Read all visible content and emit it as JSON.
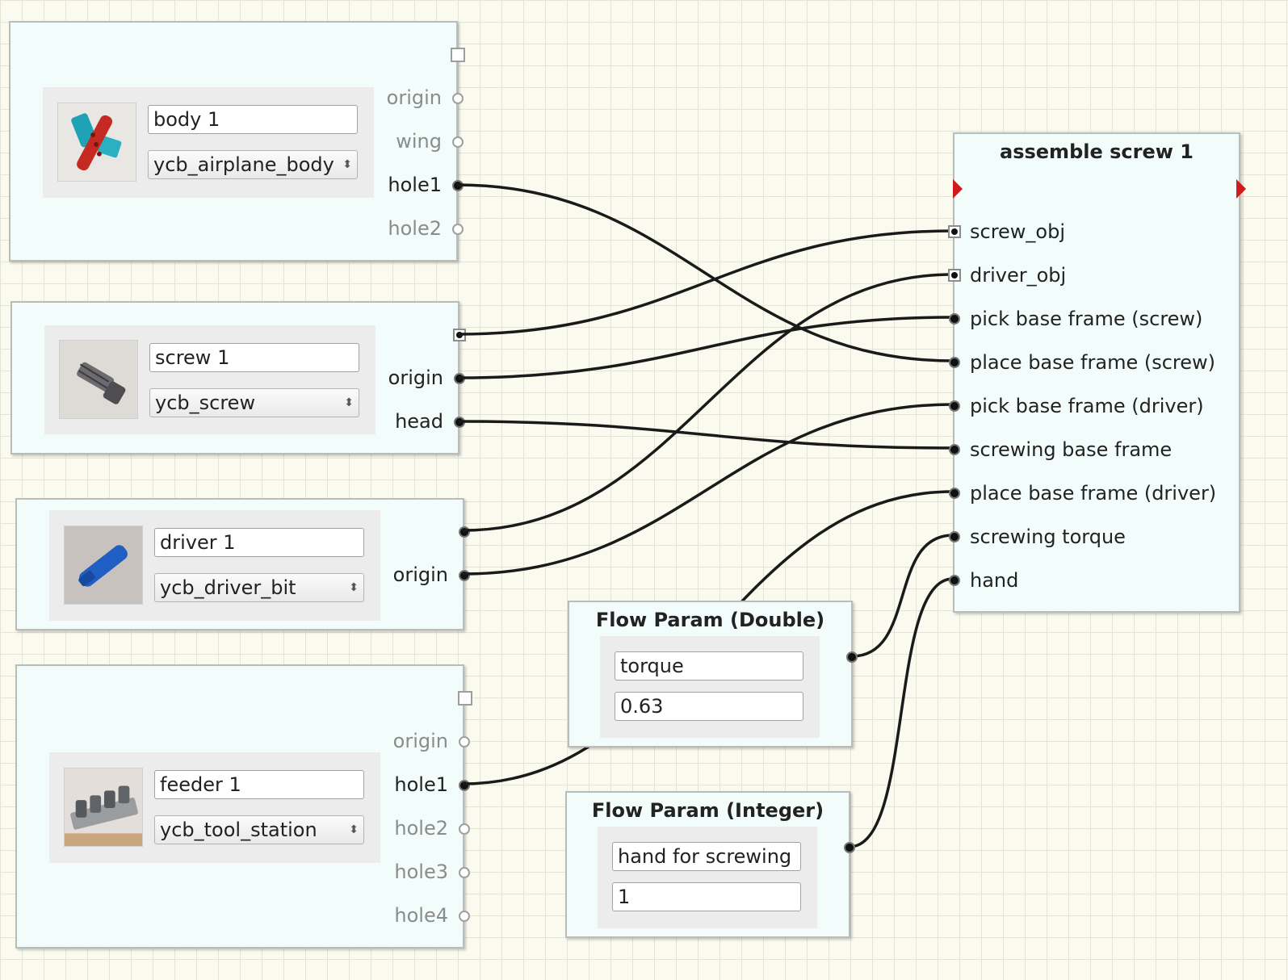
{
  "object_nodes": [
    {
      "id": "body",
      "name": "body 1",
      "type": "ycb_airplane_body",
      "ports": [
        {
          "label": "origin",
          "connected": false
        },
        {
          "label": "wing",
          "connected": false
        },
        {
          "label": "hole1",
          "connected": true
        },
        {
          "label": "hole2",
          "connected": false
        }
      ]
    },
    {
      "id": "screw",
      "name": "screw 1",
      "type": "ycb_screw",
      "ports": [
        {
          "label": "origin",
          "connected": true
        },
        {
          "label": "head",
          "connected": true
        }
      ]
    },
    {
      "id": "driver",
      "name": "driver 1",
      "type": "ycb_driver_bit",
      "ports": [
        {
          "label": "origin",
          "connected": true
        }
      ]
    },
    {
      "id": "feeder",
      "name": "feeder 1",
      "type": "ycb_tool_station",
      "ports": [
        {
          "label": "origin",
          "connected": false
        },
        {
          "label": "hole1",
          "connected": true
        },
        {
          "label": "hole2",
          "connected": false
        },
        {
          "label": "hole3",
          "connected": false
        },
        {
          "label": "hole4",
          "connected": false
        }
      ]
    }
  ],
  "assemble_node": {
    "title": "assemble screw 1",
    "inputs": [
      "screw_obj",
      "driver_obj",
      "pick base frame (screw)",
      "place base frame (screw)",
      "pick base frame (driver)",
      "screwing base frame",
      "place base frame (driver)",
      "screwing torque",
      "hand"
    ]
  },
  "param_double": {
    "title": "Flow Param (Double)",
    "name": "torque",
    "value": "0.63"
  },
  "param_integer": {
    "title": "Flow Param (Integer)",
    "name": "hand for screwing",
    "value": "1"
  },
  "colors": {
    "canvas": "#fafaee",
    "grid": "#e4e4d6",
    "node_bg": "#f2fdfb",
    "flow_arrow": "#d01b1b",
    "wire": "#1a1a1a"
  }
}
